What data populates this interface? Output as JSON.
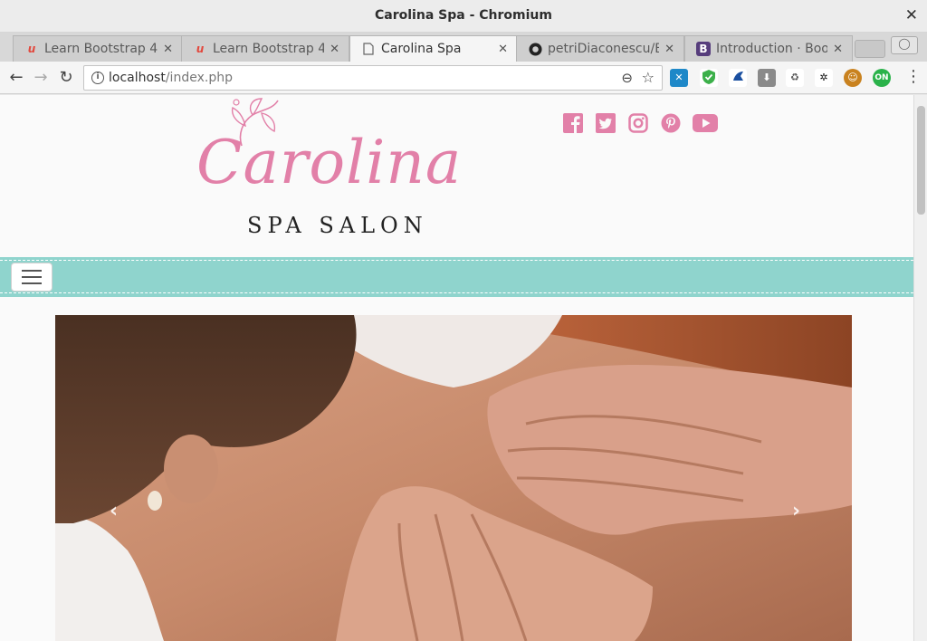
{
  "window": {
    "title": "Carolina Spa - Chromium"
  },
  "tabs": [
    {
      "label": "Learn Bootstrap 4",
      "favicon": "u",
      "active": false
    },
    {
      "label": "Learn Bootstrap 4",
      "favicon": "u",
      "active": false
    },
    {
      "label": "Carolina Spa",
      "favicon": "page",
      "active": true
    },
    {
      "label": "petriDiaconescu/B",
      "favicon": "github",
      "active": false
    },
    {
      "label": "Introduction · Boot",
      "favicon": "B",
      "active": false
    }
  ],
  "toolbar": {
    "url_host": "localhost",
    "url_path": "/index.php"
  },
  "extensions": [
    "app-icon",
    "shield-icon",
    "arrow-icon",
    "download-icon",
    "recycle-icon",
    "paw-icon",
    "face-icon",
    "power-icon"
  ],
  "site": {
    "brand": "Carolina",
    "tagline": "SPA SALON",
    "accent_color": "#e280a8",
    "nav_color": "#8fd4cd",
    "social": [
      "facebook-icon",
      "twitter-icon",
      "instagram-icon",
      "pinterest-icon",
      "youtube-icon"
    ]
  },
  "carousel": {
    "prev_label": "‹",
    "next_label": "›",
    "alt": "Back massage photo"
  }
}
